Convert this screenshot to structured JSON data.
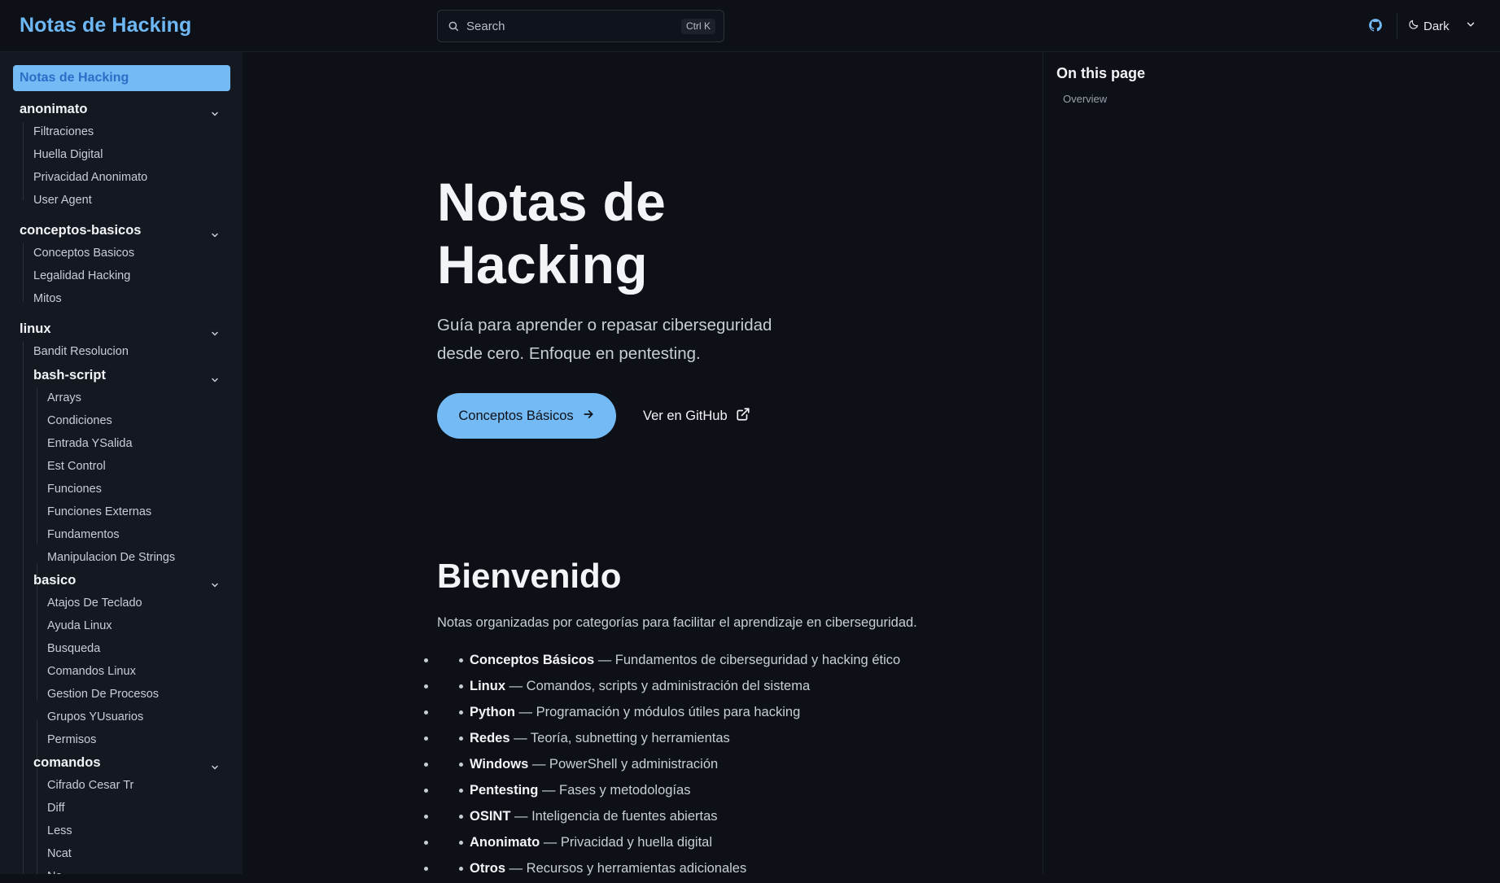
{
  "header": {
    "brand": "Notas de Hacking",
    "search_placeholder": "Search",
    "search_shortcut": "Ctrl K",
    "theme_label": "Dark"
  },
  "sidebar": {
    "active": "Notas de Hacking",
    "groups": [
      {
        "label": "anonimato",
        "items": [
          "Filtraciones",
          "Huella Digital",
          "Privacidad Anonimato",
          "User Agent"
        ]
      },
      {
        "label": "conceptos-basicos",
        "items": [
          "Conceptos Basicos",
          "Legalidad Hacking",
          "Mitos"
        ]
      },
      {
        "label": "linux",
        "items": [
          "Bandit Resolucion"
        ],
        "subgroups": [
          {
            "label": "bash-script",
            "items": [
              "Arrays",
              "Condiciones",
              "Entrada YSalida",
              "Est Control",
              "Funciones",
              "Funciones Externas",
              "Fundamentos",
              "Manipulacion De Strings"
            ]
          },
          {
            "label": "basico",
            "items": [
              "Atajos De Teclado",
              "Ayuda Linux",
              "Busqueda",
              "Comandos Linux",
              "Gestion De Procesos",
              "Grupos YUsuarios",
              "Permisos"
            ]
          },
          {
            "label": "comandos",
            "items": [
              "Cifrado Cesar Tr",
              "Diff",
              "Less",
              "Ncat",
              "Nc"
            ]
          }
        ]
      }
    ]
  },
  "hero": {
    "title": "Notas de Hacking",
    "subtitle": "Guía para aprender o repasar ciberseguridad desde cero. Enfoque en pentesting.",
    "primary_cta": "Conceptos Básicos",
    "secondary_cta": "Ver en GitHub"
  },
  "content": {
    "heading": "Bienvenido",
    "intro": "Notas organizadas por categorías para facilitar el aprendizaje en ciberseguridad.",
    "bullets": [
      {
        "title": "Conceptos Básicos",
        "desc": " — Fundamentos de ciberseguridad y hacking ético"
      },
      {
        "title": "Linux",
        "desc": " — Comandos, scripts y administración del sistema"
      },
      {
        "title": "Python",
        "desc": " — Programación y módulos útiles para hacking"
      },
      {
        "title": "Redes",
        "desc": " — Teoría, subnetting y herramientas"
      },
      {
        "title": "Windows",
        "desc": " — PowerShell y administración"
      },
      {
        "title": "Pentesting",
        "desc": " — Fases y metodologías"
      },
      {
        "title": "OSINT",
        "desc": " — Inteligencia de fuentes abiertas"
      },
      {
        "title": "Anonimato",
        "desc": " — Privacidad y huella digital"
      },
      {
        "title": "Otros",
        "desc": " — Recursos y herramientas adicionales"
      }
    ]
  },
  "toc": {
    "title": "On this page",
    "items": [
      "Overview"
    ]
  },
  "colors": {
    "accent": "#74bbf6",
    "brand": "#6db8f5",
    "background": "#0d1017",
    "sidebar_bg": "#131821"
  },
  "icons": {
    "search": "search-icon",
    "github": "github-icon",
    "theme": "moon-icon",
    "chevron": "chevron-down-icon",
    "arrow": "arrow-right-icon",
    "external": "external-link-icon"
  }
}
